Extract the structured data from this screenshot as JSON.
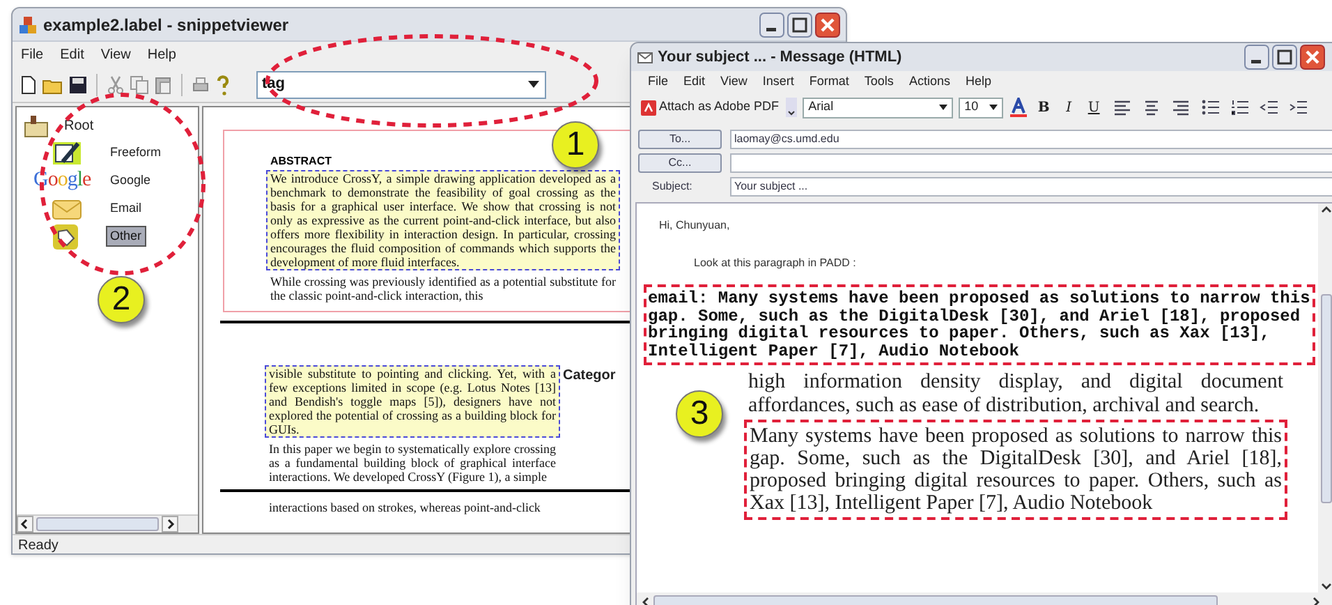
{
  "snippet_viewer": {
    "title": "example2.label - snippetviewer",
    "menu": [
      "File",
      "Edit",
      "View",
      "Help"
    ],
    "tag_field": {
      "value": "tag"
    },
    "tree": {
      "label": "Root",
      "children": [
        {
          "label": "Freeform",
          "kind": "pen",
          "selected": false
        },
        {
          "label": "Google",
          "kind": "logo",
          "logo_text": "Google",
          "selected": false
        },
        {
          "label": "Email",
          "kind": "envelope",
          "selected": false
        },
        {
          "label": "Other",
          "kind": "tag",
          "selected": true
        }
      ]
    },
    "document_pages": [
      {
        "heading": "ABSTRACT",
        "paragraphs": [
          {
            "text": "We introduce CrossY, a simple drawing application developed as a benchmark to demonstrate the feasibility of goal crossing as the basis for a graphical user interface. We show that crossing is not only as expressive as the current point-and-click interface, but also offers more flexibility in interaction design. In particular, crossing encourages the fluid composition of commands which supports the development of more fluid interfaces.",
            "highlighted": true
          },
          {
            "text": "While crossing was previously identified as a potential substitute for the classic point-and-click interaction, this",
            "highlighted": false
          }
        ]
      },
      {
        "side_heading": "Categor",
        "paragraphs": [
          {
            "text": "visible substitute to pointing and clicking. Yet, with a few exceptions limited in scope (e.g. Lotus Notes [13] and Bendish's toggle maps [5]), designers have not explored the potential of crossing as a building block for GUIs.",
            "highlighted": true
          },
          {
            "text": "In this paper we begin to systematically explore crossing as a fundamental building block of graphical interface interactions. We developed CrossY (Figure 1), a simple",
            "highlighted": false
          }
        ]
      },
      {
        "paragraphs": [
          {
            "text": "interactions based on strokes, whereas point-and-click",
            "highlighted": false
          }
        ]
      }
    ],
    "status_bar": "Ready"
  },
  "message_window": {
    "title": "Your subject ... - Message (HTML)",
    "menu": [
      "File",
      "Edit",
      "View",
      "Insert",
      "Format",
      "Tools",
      "Actions",
      "Help"
    ],
    "toolbar": {
      "attach_button": "Attach as Adobe PDF",
      "font": "Arial",
      "size": "10",
      "format_buttons": [
        "B",
        "I",
        "U"
      ]
    },
    "to_button": "To...",
    "to_value": "laomay@cs.umd.edu",
    "cc_button": "Cc...",
    "subject_label": "Subject:",
    "subject_value": "Your subject ...",
    "body": {
      "greeting": "Hi, Chunyuan,",
      "intro": "Look at this paragraph in PADD :",
      "snippet": "email: Many systems have been proposed as solutions to narrow this gap. Some, such as the DigitalDesk [30], and Ariel [18], proposed bringing digital resources to paper. Others, such as Xax [13], Intelligent Paper [7], Audio Notebook",
      "document_text": "high information density display, and digital document affordances, such as ease of distribution, archival and search.",
      "quoted_paragraph": "Many systems have been proposed as solutions to narrow this gap. Some, such as the DigitalDesk [30], and Ariel [18], proposed bringing digital resources to paper. Others, such as Xax [13], Intelligent Paper [7], Audio Notebook"
    }
  },
  "callouts": [
    "1",
    "2",
    "3"
  ]
}
